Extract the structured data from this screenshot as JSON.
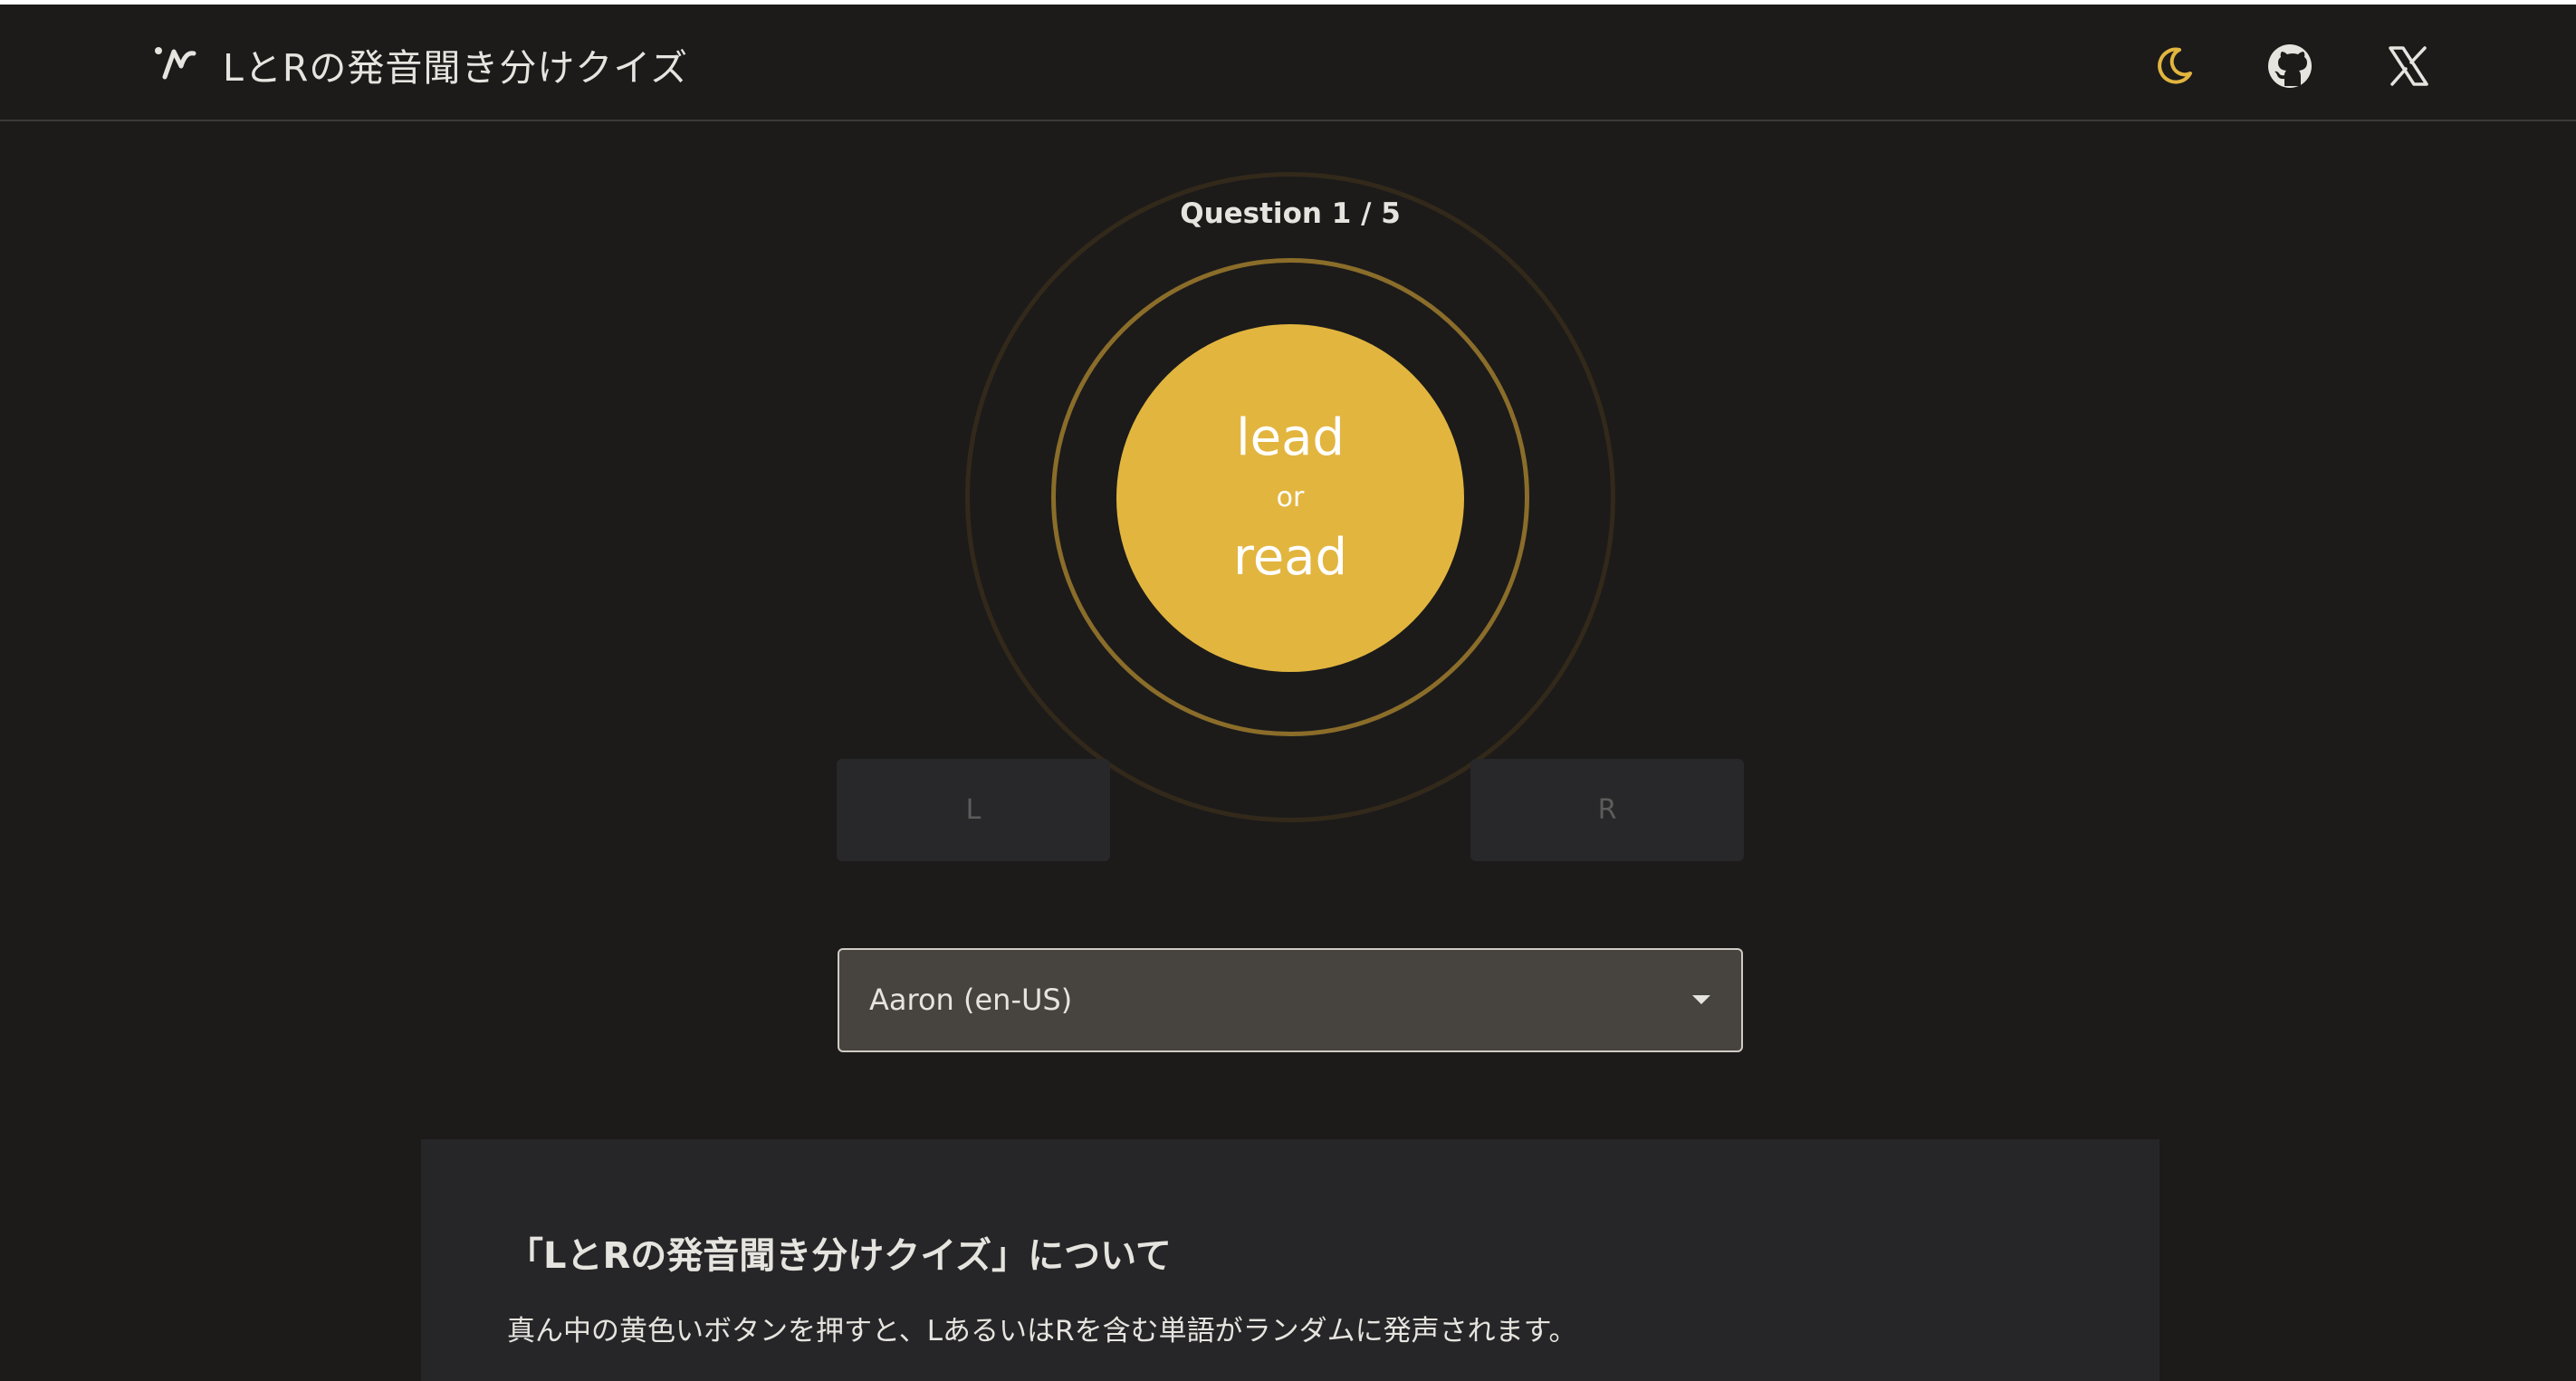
{
  "header": {
    "title": "LとRの発音聞き分けクイズ",
    "logo_icon": "logo-icon",
    "icons": [
      "moon-icon",
      "github-icon",
      "x-logo-icon"
    ]
  },
  "quiz": {
    "counter": "Question 1 / 5",
    "word_a": "lead",
    "connector": "or",
    "word_b": "read",
    "button_l": "L",
    "button_r": "R"
  },
  "voice": {
    "selected": "Aaron (en-US)"
  },
  "about": {
    "title": "「LとRの発音聞き分けクイズ」について",
    "text": "真ん中の黄色いボタンを押すと、LあるいはRを含む単語がランダムに発声されます。"
  },
  "colors": {
    "background": "#1c1b1a",
    "accent": "#e2b53f",
    "panel": "#262628"
  }
}
